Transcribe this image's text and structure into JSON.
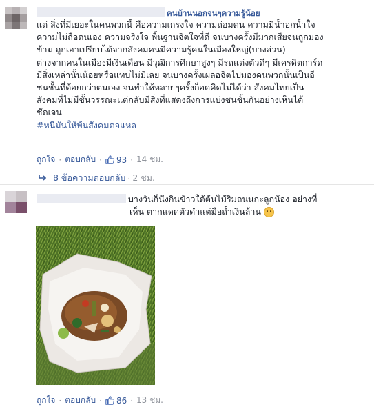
{
  "comment1": {
    "name_suffix": "คนบ้านนอกจนๆความรู้น้อย",
    "lines": [
      "แต่ สิ่งที่มีเยอะในคนพวกนี้ คือความเกรงใจ ความถ่อมตน ความมีน้ำอกน้ำใจ",
      "ความไม่ถือตนเอง ความจริงใจ พื้นฐานจิตใจที่ดี จนบางครั้งมีมากเสียจนถูกมอง",
      "ข้าม ถูกเอาเปรียบได้จากสังคมคนมีความรู้คนในเมืองใหญ่(บางส่วน)",
      "ต่างจากคนในเมืองมีเงินเดือน มีวุฒิการศึกษาสูงๆ มีรถแต่งตัวดีๆ มีเครดิตการ์ด",
      "มีสิ่งเหล่านั้นน้อยหรือแทบไม่มีเลย จนบางครั้งเผลอจิตไปมองคนพวกนั้นเป็นอี",
      "ชนชั้นที่ด้อยกว่าตนเอง จนทำให้หลายๆครั้งก็อดคิดไม่ได้ว่า สังคมไทยเป็น",
      "สังคมที่ไม่มีชั้นวรรณะแต่กลับมีสิ่งที่แสดงถึงการแบ่งชนชั้นกันอย่างเห็นได้",
      "ชัดเจน"
    ],
    "hashtag": "#หนีมันให้พ้นสังคมตอแหล",
    "like_label": "ถูกใจ",
    "reply_label": "ตอบกลับ",
    "likes": "93",
    "time": "14 ชม.",
    "replies_label": "8 ข้อความตอบกลับ",
    "replies_time": "2 ชม."
  },
  "comment2": {
    "text_line1": "บางวันก็นั่งกินข้าวใต้ต้นไม้ริมถนนกะลูกน้อง อย่างที่",
    "text_line2": "เห็น ตากแดดตัวดำแต่มือถ้ำเงินล้าน",
    "like_label": "ถูกใจ",
    "reply_label": "ตอบกลับ",
    "likes": "86",
    "time": "13 ชม."
  },
  "colors": {
    "link": "#365899",
    "meta": "#90949c",
    "text": "#1d2129",
    "like_blue": "#4267b2"
  },
  "icons": [
    "like-thumb-icon",
    "reply-arrow-icon",
    "grin-emoji-icon"
  ]
}
